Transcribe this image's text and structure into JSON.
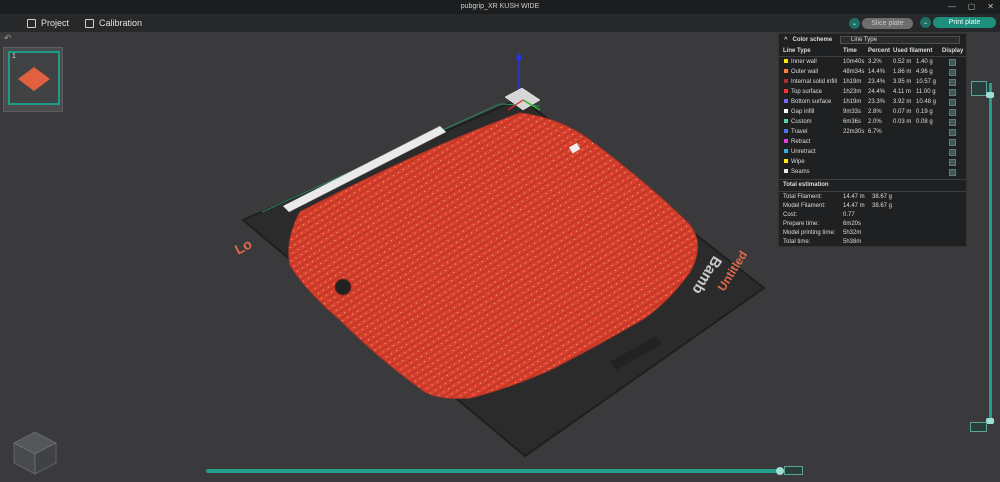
{
  "window": {
    "title": "pubgrip_XR KUSH WIDE"
  },
  "menu": {
    "project": "Project",
    "calibration": "Calibration"
  },
  "toolbar": {
    "slice": "Slice plate",
    "print": "Print plate"
  },
  "plate_list": {
    "number": "1"
  },
  "bed": {
    "left_label": "Lo",
    "right_label": "Untitled",
    "brand": "Bamb"
  },
  "legend": {
    "header": "Color scheme",
    "scheme": "Line Type",
    "columns": {
      "type": "Line Type",
      "time": "Time",
      "percent": "Percent",
      "used": "Used filament",
      "display": "Display"
    },
    "rows": [
      {
        "name": "Inner wall",
        "color": "#ffe600",
        "time": "10m40s",
        "percent": "3.2%",
        "len": "0.52 m",
        "weight": "1.40 g"
      },
      {
        "name": "Outer wall",
        "color": "#ff7d38",
        "time": "48m34s",
        "percent": "14.4%",
        "len": "1.86 m",
        "weight": "4.96 g"
      },
      {
        "name": "Internal solid infill",
        "color": "#b03029",
        "time": "1h19m",
        "percent": "23.4%",
        "len": "3.95 m",
        "weight": "10.57 g"
      },
      {
        "name": "Top surface",
        "color": "#ff3030",
        "time": "1h23m",
        "percent": "24.4%",
        "len": "4.11 m",
        "weight": "11.00 g"
      },
      {
        "name": "Bottom surface",
        "color": "#7a6aff",
        "time": "1h19m",
        "percent": "23.3%",
        "len": "3.92 m",
        "weight": "10.48 g"
      },
      {
        "name": "Gap infill",
        "color": "#ffffff",
        "time": "9m33s",
        "percent": "2.8%",
        "len": "0.07 m",
        "weight": "0.19 g"
      },
      {
        "name": "Custom",
        "color": "#5fd0a0",
        "time": "6m36s",
        "percent": "2.0%",
        "len": "0.03 m",
        "weight": "0.08 g"
      },
      {
        "name": "Travel",
        "color": "#4a78e8",
        "time": "22m30s",
        "percent": "6.7%",
        "len": "",
        "weight": ""
      },
      {
        "name": "Retract",
        "color": "#e040e0",
        "time": "",
        "percent": "",
        "len": "",
        "weight": ""
      },
      {
        "name": "Unretract",
        "color": "#3ab0e0",
        "time": "",
        "percent": "",
        "len": "",
        "weight": ""
      },
      {
        "name": "Wipe",
        "color": "#ffee00",
        "time": "",
        "percent": "",
        "len": "",
        "weight": ""
      },
      {
        "name": "Seams",
        "color": "#e8e8e8",
        "time": "",
        "percent": "",
        "len": "",
        "weight": ""
      }
    ],
    "totals_title": "Total estimation",
    "totals": [
      {
        "label": "Total Filament:",
        "a": "14.47 m",
        "b": "38.67 g"
      },
      {
        "label": "Model Filament:",
        "a": "14.47 m",
        "b": "38.67 g"
      },
      {
        "label": "Cost:",
        "a": "0.77",
        "b": ""
      },
      {
        "label": "Prepare time:",
        "a": "6m20s",
        "b": ""
      },
      {
        "label": "Model printing time:",
        "a": "5h32m",
        "b": ""
      },
      {
        "label": "Total time:",
        "a": "5h38m",
        "b": ""
      }
    ]
  },
  "colors": {
    "accent": "#1d8f7c",
    "filament": "#d8402c"
  }
}
